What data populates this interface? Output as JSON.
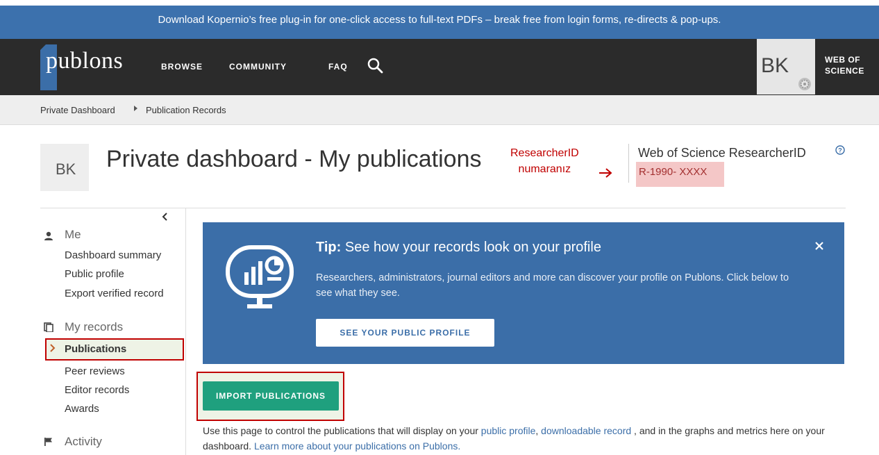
{
  "banner": {
    "text": "Download Kopernio’s free plug-in for one-click access to full-text PDFs – break free from login forms, re-directs & pop-ups."
  },
  "navbar": {
    "logo_text": "publons",
    "items": [
      "BROWSE",
      "COMMUNITY",
      "FAQ"
    ],
    "user_initials": "BK",
    "wos_line1": "WEB OF",
    "wos_line2": "SCIENCE"
  },
  "breadcrumb": {
    "items": [
      "Private Dashboard",
      "Publication Records"
    ]
  },
  "header": {
    "avatar_initials": "BK",
    "title": "Private dashboard - My publications",
    "annotation_line1": "ResearcherID",
    "annotation_line2": "numaranız",
    "rid_label": "Web of Science ResearcherID",
    "rid_value": "R-1990- XXXX"
  },
  "sidebar": {
    "me_label": "Me",
    "me_items": [
      "Dashboard summary",
      "Public profile",
      "Export verified record"
    ],
    "records_label": "My records",
    "records_items": [
      "Publications",
      "Peer reviews",
      "Editor records",
      "Awards"
    ],
    "activity_label": "Activity"
  },
  "tip": {
    "title_prefix": "Tip:",
    "title_rest": " See how your records look on your profile",
    "body": "Researchers, administrators, journal editors and more can discover your profile on Publons. Click below to see what they see.",
    "button": "SEE YOUR PUBLIC PROFILE"
  },
  "import_button": "IMPORT PUBLICATIONS",
  "description": {
    "part1": "Use this page to control the publications that will display on your ",
    "link1": "public profile",
    "part2": ", ",
    "link2": "downloadable record",
    "part3": " , and in the graphs and metrics here on your dashboard. ",
    "link3": "Learn more about your publications on Publons."
  },
  "colors": {
    "banner": "#3c71ad",
    "navbar": "#2b2b2b",
    "accent_blue": "#3b6ea8",
    "import_green": "#1fa07e",
    "annotation_red": "#c00000"
  }
}
